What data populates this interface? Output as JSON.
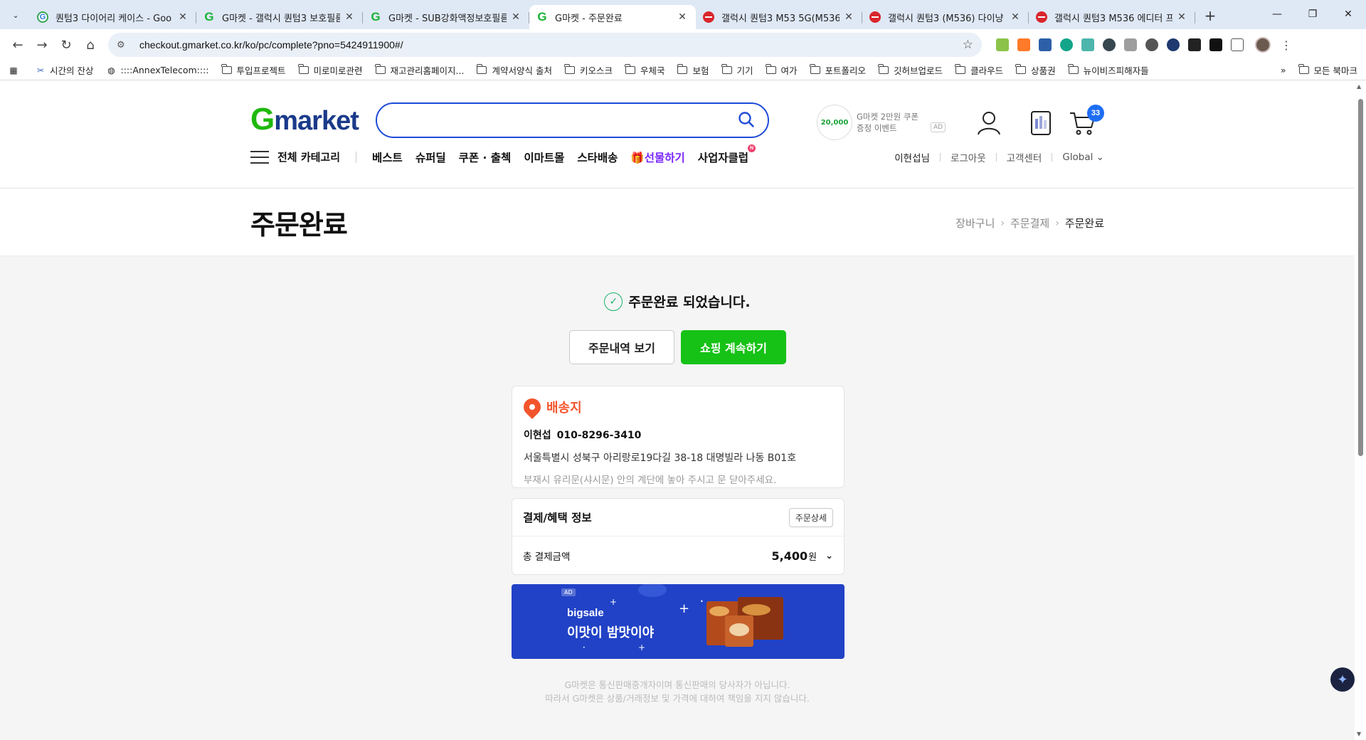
{
  "browser": {
    "tabs": [
      {
        "title": "퀀텀3 다이어리 케이스 - Goo",
        "favicon": "g",
        "active": false
      },
      {
        "title": "G마켓 - 갤럭시 퀀텀3 보호필름",
        "favicon": "gm",
        "active": false
      },
      {
        "title": "G마켓 - SUB강화액정보호필름",
        "favicon": "gm",
        "active": false
      },
      {
        "title": "G마켓 - 주문완료",
        "favicon": "gm",
        "active": true
      },
      {
        "title": "갤럭시 퀀텀3 M53 5G(M536)",
        "favicon": "red",
        "active": false
      },
      {
        "title": "갤럭시 퀀텀3 (M536) 다이냥",
        "favicon": "red",
        "active": false
      },
      {
        "title": "갤럭시 퀀텀3 M536 에디터 프",
        "favicon": "red",
        "active": false
      }
    ],
    "url": "checkout.gmarket.co.kr/ko/pc/complete?pno=5424911900#/",
    "bookmarks": [
      {
        "label": "시간의 잔상",
        "type": "site"
      },
      {
        "label": "::::AnnexTelecom::::",
        "type": "site"
      },
      {
        "label": "투입프로젝트",
        "type": "folder"
      },
      {
        "label": "미로미로관련",
        "type": "folder"
      },
      {
        "label": "재고관리홈페이지...",
        "type": "folder"
      },
      {
        "label": "계약서양식 출처",
        "type": "folder"
      },
      {
        "label": "키오스크",
        "type": "folder"
      },
      {
        "label": "우체국",
        "type": "folder"
      },
      {
        "label": "보험",
        "type": "folder"
      },
      {
        "label": "기기",
        "type": "folder"
      },
      {
        "label": "여가",
        "type": "folder"
      },
      {
        "label": "포트폴리오",
        "type": "folder"
      },
      {
        "label": "깃허브업로드",
        "type": "folder"
      },
      {
        "label": "클라우드",
        "type": "folder"
      },
      {
        "label": "상품권",
        "type": "folder"
      },
      {
        "label": "뉴이비즈피해자들",
        "type": "folder"
      }
    ],
    "all_bookmarks": "모든 북마크",
    "overflow": "»"
  },
  "header": {
    "logo": {
      "g": "G",
      "rest": "market"
    },
    "search_placeholder": "",
    "coupon_ad": {
      "amount": "20,000",
      "line1": "G마켓 2만원 쿠폰",
      "line2": "증정 이벤트",
      "ad": "AD"
    },
    "cart_count": "33",
    "all_category": "전체 카테고리",
    "menus": [
      "베스트",
      "슈퍼딜",
      "쿠폰 · 출첵",
      "이마트몰",
      "스타배송"
    ],
    "gift": "🎁선물하기",
    "biz": "사업자클럽",
    "new_badge": "N",
    "util": {
      "user": "이현섭님",
      "logout": "로그아웃",
      "cs": "고객센터",
      "global": "Global ⌄"
    }
  },
  "title": {
    "heading": "주문완료",
    "breadcrumb": [
      "장바구니",
      "주문결제",
      "주문완료"
    ]
  },
  "complete": {
    "message": "주문완료 되었습니다.",
    "btn_view": "주문내역 보기",
    "btn_continue": "쇼핑 계속하기"
  },
  "shipping": {
    "heading": "배송지",
    "name": "이현섭",
    "phone": "010-8296-3410",
    "address": "서울특별시 성북구 아리랑로19다길 38-18 대명빌라 나동 B01호",
    "memo": "부재시 유리문(샤시문) 안의 계단에 놓아 주시고 문 닫아주세요."
  },
  "payment": {
    "heading": "결제/혜택 정보",
    "detail_btn": "주문상세",
    "total_label": "총 결제금액",
    "total_value": "5,400",
    "currency": "원"
  },
  "banner": {
    "ad": "AD",
    "brand": "bigsale",
    "copy": "이맛이 밤맛이야"
  },
  "footer": {
    "line1": "G마켓은 통신판매중개자이며 통신판매의 당사자가 아닙니다.",
    "line2": "따라서 G마켓은 상품/거래정보 및 가격에 대하여 책임을 지지 않습니다."
  },
  "colors": {
    "brand_green": "#16c216",
    "brand_blue": "#1e4bd8",
    "ship_orange": "#f2552c",
    "gift_purple": "#7b28ff"
  }
}
